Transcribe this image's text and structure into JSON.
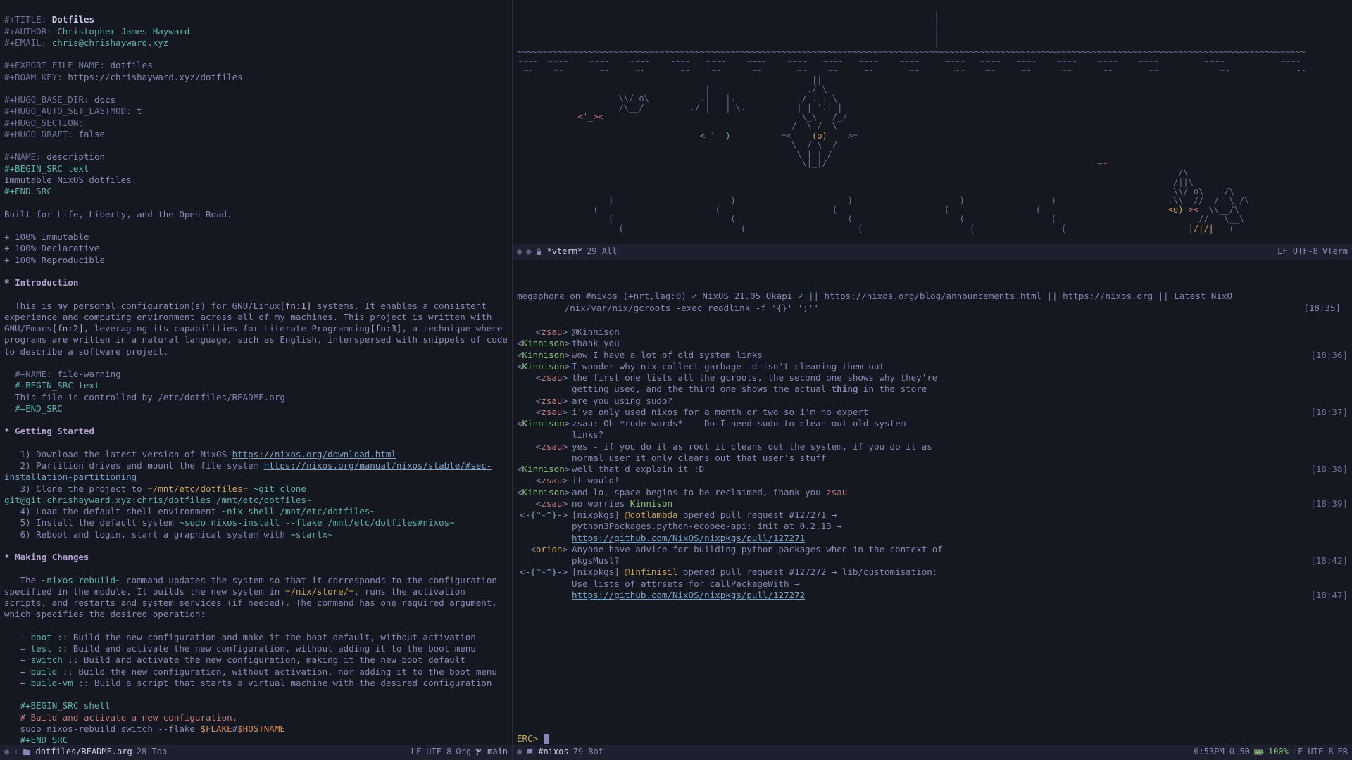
{
  "left": {
    "title_key": "#+TITLE:",
    "title_val": "Dotfiles",
    "author_key": "#+AUTHOR:",
    "author_val": "Christopher James Hayward",
    "email_key": "#+EMAIL:",
    "email_val": "chris@chrishayward.xyz",
    "export_key": "#+EXPORT_FILE_NAME:",
    "export_val": "dotfiles",
    "roam_key": "#+ROAM_KEY:",
    "roam_val": "https://chrishayward.xyz/dotfiles",
    "hugo_base_key": "#+HUGO_BASE_DIR:",
    "hugo_base_val": "docs",
    "hugo_last_key": "#+HUGO_AUTO_SET_LASTMOD:",
    "hugo_last_val": "t",
    "hugo_sec_key": "#+HUGO_SECTION:",
    "hugo_draft_key": "#+HUGO_DRAFT:",
    "hugo_draft_val": "false",
    "name_desc_key": "#+NAME:",
    "name_desc_val": "description",
    "begin_text": "#+BEGIN_SRC text",
    "desc_body": "Immutable NixOS dotfiles.",
    "end_src": "#+END_SRC",
    "tagline": "Built for Life, Liberty, and the Open Road.",
    "bullets": [
      "+ 100% Immutable",
      "+ 100% Declarative",
      "+ 100% Reproducible"
    ],
    "h_intro": "Introduction",
    "intro_p1a": "This is my personal configuration(s) for GNU/Linux",
    "fn1": "[fn:1]",
    "intro_p1b": " systems. It enables a consistent experience and computing environment across all of my machines. This project is written with GNU/Emacs",
    "fn2": "[fn:2]",
    "intro_p1c": ", leveraging its capabilities for Literate Programming",
    "fn3": "[fn:3]",
    "intro_p1d": ", a technique where programs are written in a natural language, such as English, interspersed with snippets of code to describe a software project.",
    "name_warn_val": "file-warning",
    "warn_body": "This file is controlled by /etc/dotfiles/README.org",
    "h_start": "Getting Started",
    "s1a": "1) Download the latest version of NixOS ",
    "s1b": "https://nixos.org/download.html",
    "s2a": "2) Partition drives and mount the file system ",
    "s2b": "https://nixos.org/manual/nixos/stable/#sec-installation-partitioning",
    "s3a": "3) Clone the project to ",
    "s3b": "=/mnt/etc/dotfiles=",
    "s3c": " ~git clone git@git.chrishayward.xyz:chris/dotfiles /mnt/etc/dotfiles~",
    "s4a": "4) Load the default shell environment ",
    "s4b": "~nix-shell /mnt/etc/dotfiles~",
    "s5a": "5) Install the default system ",
    "s5b": "~sudo nixos-install --flake /mnt/etc/dotfiles#nixos~",
    "s6a": "6) Reboot and login, start a graphical system with ",
    "s6b": "~startx~",
    "h_mk": "Making Changes",
    "mk_p_a": "The ",
    "mk_p_b": "~nixos-rebuild~",
    "mk_p_c": " command updates the system so that it corresponds to the configuration specified in the module. It builds the new system in ",
    "mk_p_d": "=/nix/store/=",
    "mk_p_e": ", runs the activation scripts, and restarts and system services (if needed). The command has one required argument, which specifies the desired operation:",
    "ops": [
      {
        "k": "boot",
        "d": "Build the new configuration and make it the boot default, without activation"
      },
      {
        "k": "test",
        "d": "Build and activate the new configuration, without adding it to the boot menu"
      },
      {
        "k": "switch",
        "d": "Build and activate the new configuration, making it the new boot default"
      },
      {
        "k": "build",
        "d": "Build the new configuration, without activation, nor adding it to the boot menu"
      },
      {
        "k": "build-vm",
        "d": "Build a script that starts a virtual machine with the desired configuration"
      }
    ],
    "begin_shell": "#+BEGIN_SRC shell",
    "shell_cmt": "# Build and activate a new configuration.",
    "shell_a": "sudo nixos-rebuild switch --flake ",
    "shell_b": "$FLAKE",
    "shell_c": "#",
    "shell_d": "$HOSTNAME",
    "ml": {
      "buf": "dotfiles/README.org",
      "pos": "28 Top",
      "enc": "LF UTF-8",
      "mode": "Org",
      "branch": "main"
    }
  },
  "vterm": {
    "ml": {
      "buf": "*vterm*",
      "pos": "29 All",
      "enc": "LF UTF-8",
      "mode": "VTerm"
    }
  },
  "irc": {
    "topic_a": "megaphone on #nixos (+nrt,lag:0) ",
    "topic_b": " NixOS 21.05 Okapi ",
    "topic_c": " || https://nixos.org/blog/announcements.html || https://nixos.org || Latest NixO",
    "topic2": "         /nix/var/nix/gcroots -exec readlink -f '{}' ';''",
    "t0": "[18:35]",
    "lines": [
      {
        "n": "zsau",
        "c": "nick-z",
        "m": "@Kinnison",
        "t": ""
      },
      {
        "n": "Kinnison",
        "c": "nick-k",
        "m": "thank you",
        "t": ""
      },
      {
        "n": "Kinnison",
        "c": "nick-k",
        "m": "wow I have a lot of old system links",
        "t": "[18:36]"
      },
      {
        "n": "Kinnison",
        "c": "nick-k",
        "m": "I wonder why nix-collect-garbage -d isn't cleaning them out",
        "t": ""
      },
      {
        "n": "zsau",
        "c": "nick-z",
        "m": "the first one lists all the gcroots, the second one shows why they're",
        "t": ""
      },
      {
        "n": "",
        "c": "",
        "m": "getting used, and the third one shows the actual <b>thing</b> in the store",
        "t": ""
      },
      {
        "n": "zsau",
        "c": "nick-z",
        "m": "are you using sudo?",
        "t": ""
      },
      {
        "n": "zsau",
        "c": "nick-z",
        "m": "i've only used nixos for a month or two so i'm no expert",
        "t": "[18:37]"
      },
      {
        "n": "Kinnison",
        "c": "nick-k",
        "m": "zsau: Oh *rude words* -- Do I need sudo to clean out old system",
        "t": ""
      },
      {
        "n": "",
        "c": "",
        "m": "links?",
        "t": ""
      },
      {
        "n": "zsau",
        "c": "nick-z",
        "m": "yes - if you do it as root it cleans out the system, if you do it as",
        "t": ""
      },
      {
        "n": "",
        "c": "",
        "m": "normal user it only cleans out that user's stuff",
        "t": ""
      },
      {
        "n": "Kinnison",
        "c": "nick-k",
        "m": "well that'd explain it :D",
        "t": "[18:38]"
      },
      {
        "n": "zsau",
        "c": "nick-z",
        "m": "it would!",
        "t": ""
      },
      {
        "n": "Kinnison",
        "c": "nick-k",
        "m": "and lo, space begins to be reclaimed, thank you <span class='nick-z'>zsau</span>",
        "t": ""
      },
      {
        "n": "zsau",
        "c": "nick-z",
        "m": "no worries <span class='nick-k'>Kinnison</span>",
        "t": "[18:39]"
      },
      {
        "n": "-{^-^}-",
        "c": "nick-b",
        "m": "[nixpkgs] <span class='nick-o'>@dotlambda</span> opened pull request #127271 →",
        "t": ""
      },
      {
        "n": "",
        "c": "",
        "m": "python3Packages.python-ecobee-api: init at 0.2.13 →",
        "t": ""
      },
      {
        "n": "",
        "c": "",
        "m": "<span class='link'>https://github.com/NixOS/nixpkgs/pull/127271</span>",
        "t": ""
      },
      {
        "n": "orion",
        "c": "nick-o",
        "m": "Anyone have advice for building python packages when in the context of",
        "t": ""
      },
      {
        "n": "",
        "c": "",
        "m": "pkgsMusl?",
        "t": "[18:42]"
      },
      {
        "n": "-{^-^}-",
        "c": "nick-b",
        "m": "[nixpkgs] <span class='nick-o'>@Infinisil</span> opened pull request #127272 → lib/customisation:",
        "t": ""
      },
      {
        "n": "",
        "c": "",
        "m": "Use lists of attrsets for callPackageWith →",
        "t": ""
      },
      {
        "n": "",
        "c": "",
        "m": "<span class='link'>https://github.com/NixOS/nixpkgs/pull/127272</span>",
        "t": "[18:47]"
      }
    ],
    "prompt": "ERC>",
    "ml": {
      "buf": "#nixos",
      "pos": "79 Bot",
      "time": "6:53PM 0.50",
      "batt": "100%",
      "enc": "LF UTF-8",
      "mode": "ER"
    }
  }
}
